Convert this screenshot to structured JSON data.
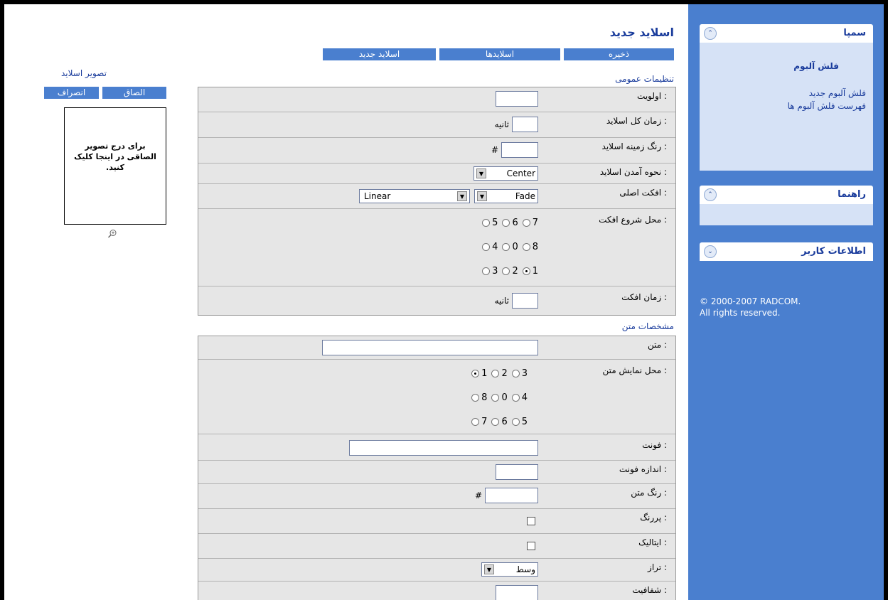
{
  "sidebar": {
    "panels": [
      {
        "title": "سمپا",
        "toggle": "⌃",
        "items": [
          "فلش آلبوم",
          "فلش آلبوم جدید",
          "فهرست فلش آلبوم ها"
        ]
      },
      {
        "title": "راهنما",
        "toggle": "⌃"
      },
      {
        "title": "اطلاعات کاربر",
        "toggle": "⌄"
      }
    ],
    "copyright": [
      "© 2000-2007 RADCOM.",
      "All rights reserved."
    ]
  },
  "page": {
    "title": "اسلاید جدید",
    "toolbar": {
      "save": "ذخیره",
      "slides": "اسلایدها",
      "new_slide": "اسلاید جدید"
    },
    "general_section": "تنظیمات عمومی",
    "text_section": "مشخصات متن"
  },
  "general": {
    "priority": {
      "label": "اولویت :",
      "value": ""
    },
    "total_time": {
      "label": "زمان کل اسلاید :",
      "unit": "ثانیه",
      "value": ""
    },
    "bg_color": {
      "label": "رنگ زمینه اسلاید :",
      "prefix": "#",
      "value": ""
    },
    "entry": {
      "label": "نحوه آمدن اسلاید :",
      "value": "Center"
    },
    "main_effect": {
      "label": "افکت اصلی :",
      "value1": "Fade",
      "value2": "Linear"
    },
    "effect_start": {
      "label": "محل شروع افکت :",
      "rows": [
        [
          "5",
          "6",
          "7"
        ],
        [
          "4",
          "0",
          "8"
        ],
        [
          "3",
          "2",
          "1"
        ]
      ],
      "selected": "1"
    },
    "effect_time": {
      "label": "زمان افکت :",
      "unit": "ثانیه",
      "value": ""
    }
  },
  "text": {
    "text": {
      "label": "متن :",
      "value": ""
    },
    "position": {
      "label": "محل نمایش متن :",
      "rows": [
        [
          "1",
          "2",
          "3"
        ],
        [
          "8",
          "0",
          "4"
        ],
        [
          "7",
          "6",
          "5"
        ]
      ],
      "selected": "1"
    },
    "font": {
      "label": "فونت :",
      "value": ""
    },
    "font_size": {
      "label": "اندازه فونت :",
      "value": ""
    },
    "color": {
      "label": "رنگ متن :",
      "prefix": "#",
      "value": ""
    },
    "bold": {
      "label": "پررنگ :",
      "checked": false
    },
    "italic": {
      "label": "ایتالیک :",
      "checked": false
    },
    "align": {
      "label": "تراز :",
      "value": "وسط"
    },
    "opacity": {
      "label": "شفافیت :",
      "value": ""
    }
  },
  "image": {
    "title": "تصویر اسلاید",
    "paste": "الصاق",
    "cancel": "انصراف",
    "placeholder": "برای درج تصویر الصاقی در اینجا کلیک کنید."
  }
}
